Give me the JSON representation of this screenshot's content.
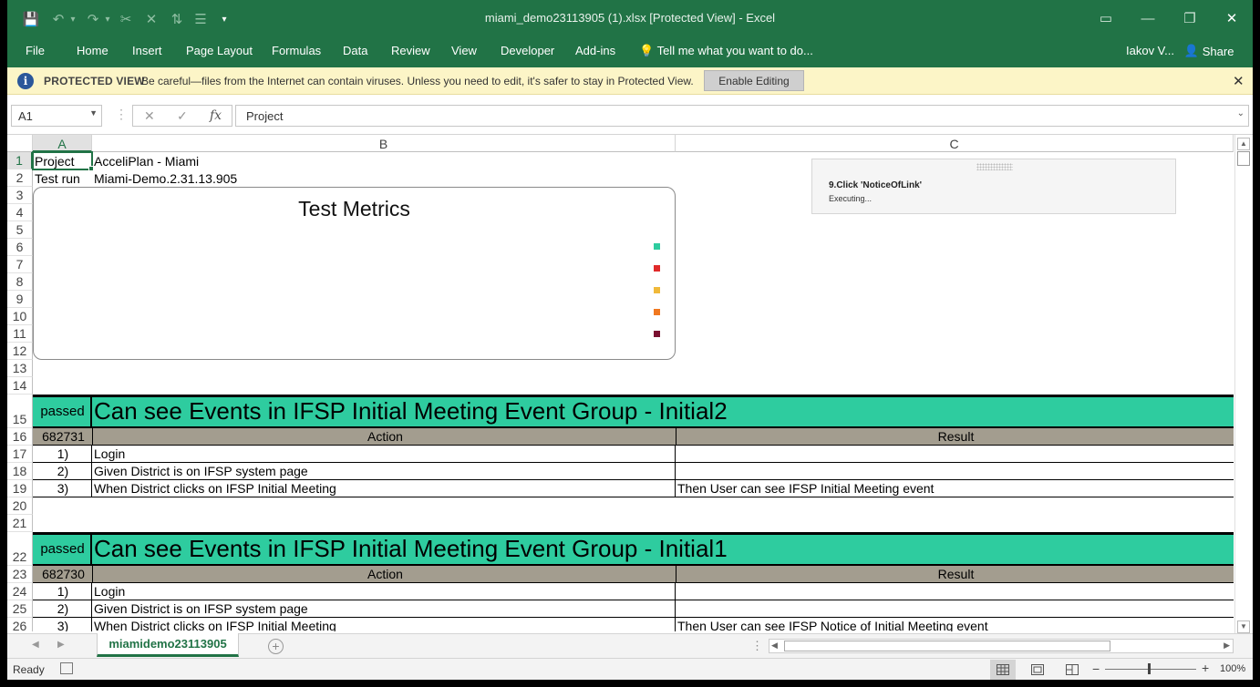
{
  "window": {
    "title": "miami_demo23113905 (1).xlsx  [Protected View] - Excel",
    "user": "Iakov V...",
    "share": "Share"
  },
  "qat": [
    {
      "icon": "save-icon",
      "glyph": "💾",
      "dim": false
    },
    {
      "icon": "undo-icon",
      "glyph": "↶",
      "dim": true
    },
    {
      "icon": "undo-dropdown-icon",
      "glyph": "▾",
      "dim": true
    },
    {
      "icon": "redo-icon",
      "glyph": "↷",
      "dim": true
    },
    {
      "icon": "redo-dropdown-icon",
      "glyph": "▾",
      "dim": true
    },
    {
      "icon": "format-painter-icon",
      "glyph": "✂",
      "dim": true
    },
    {
      "icon": "clear-icon",
      "glyph": "✕",
      "dim": true
    },
    {
      "icon": "sort-icon",
      "glyph": "⇅",
      "dim": true
    },
    {
      "icon": "filter-icon",
      "glyph": "☰",
      "dim": true
    },
    {
      "icon": "customize-qat-icon",
      "glyph": "▾",
      "dim": false
    }
  ],
  "ribbon_tabs": [
    "File",
    "Home",
    "Insert",
    "Page Layout",
    "Formulas",
    "Data",
    "Review",
    "View",
    "Developer",
    "Add-ins"
  ],
  "tell_me": "Tell me what you want to do...",
  "protected_view": {
    "title": "PROTECTED VIEW",
    "message": "Be careful—files from the Internet can contain viruses. Unless you need to edit, it's safer to stay in Protected View.",
    "button": "Enable Editing"
  },
  "formula_bar": {
    "name_box": "A1",
    "formula": "Project"
  },
  "columns": [
    "A",
    "B",
    "C"
  ],
  "rows": [
    "1",
    "2",
    "3",
    "4",
    "5",
    "6",
    "7",
    "8",
    "9",
    "10",
    "11",
    "12",
    "13",
    "14",
    "15",
    "16",
    "17",
    "18",
    "19",
    "20",
    "21",
    "22",
    "23",
    "24",
    "25",
    "26"
  ],
  "header_rows": {
    "r1": {
      "a": "Project",
      "b": "AcceliPlan - Miami"
    },
    "r2": {
      "a": "Test run",
      "b": "Miami-Demo.2.31.13.905"
    }
  },
  "chart": {
    "title": "Test Metrics",
    "legend_colors": [
      "#2ecc9f",
      "#e02a2a",
      "#f0b93a",
      "#f07820",
      "#7a1030"
    ]
  },
  "notification": {
    "title": "9.Click 'NoticeOfLink'",
    "status": "Executing..."
  },
  "tests": [
    {
      "status": "passed",
      "name": "Can see Events in IFSP Initial Meeting Event Group  - Initial2",
      "id": "682731",
      "action_header": "Action",
      "result_header": "Result",
      "steps": [
        {
          "num": "1)",
          "action": "Login",
          "result": ""
        },
        {
          "num": "2)",
          "action": "Given District is on IFSP system page",
          "result": ""
        },
        {
          "num": "3)",
          "action": "When District clicks on IFSP Initial Meeting",
          "result": "Then User can see IFSP Initial Meeting event"
        }
      ]
    },
    {
      "status": "passed",
      "name": "Can see Events in IFSP Initial Meeting Event Group  - Initial1",
      "id": "682730",
      "action_header": "Action",
      "result_header": "Result",
      "steps": [
        {
          "num": "1)",
          "action": "Login",
          "result": ""
        },
        {
          "num": "2)",
          "action": "Given District is on IFSP system page",
          "result": ""
        },
        {
          "num": "3)",
          "action": "When District clicks on IFSP Initial Meeting",
          "result": "Then User can see IFSP Notice of Initial Meeting event"
        }
      ]
    }
  ],
  "sheet_tab": "miamidemo23113905",
  "status": {
    "ready": "Ready",
    "zoom": "100%",
    "zoom_level_percent": 100
  }
}
